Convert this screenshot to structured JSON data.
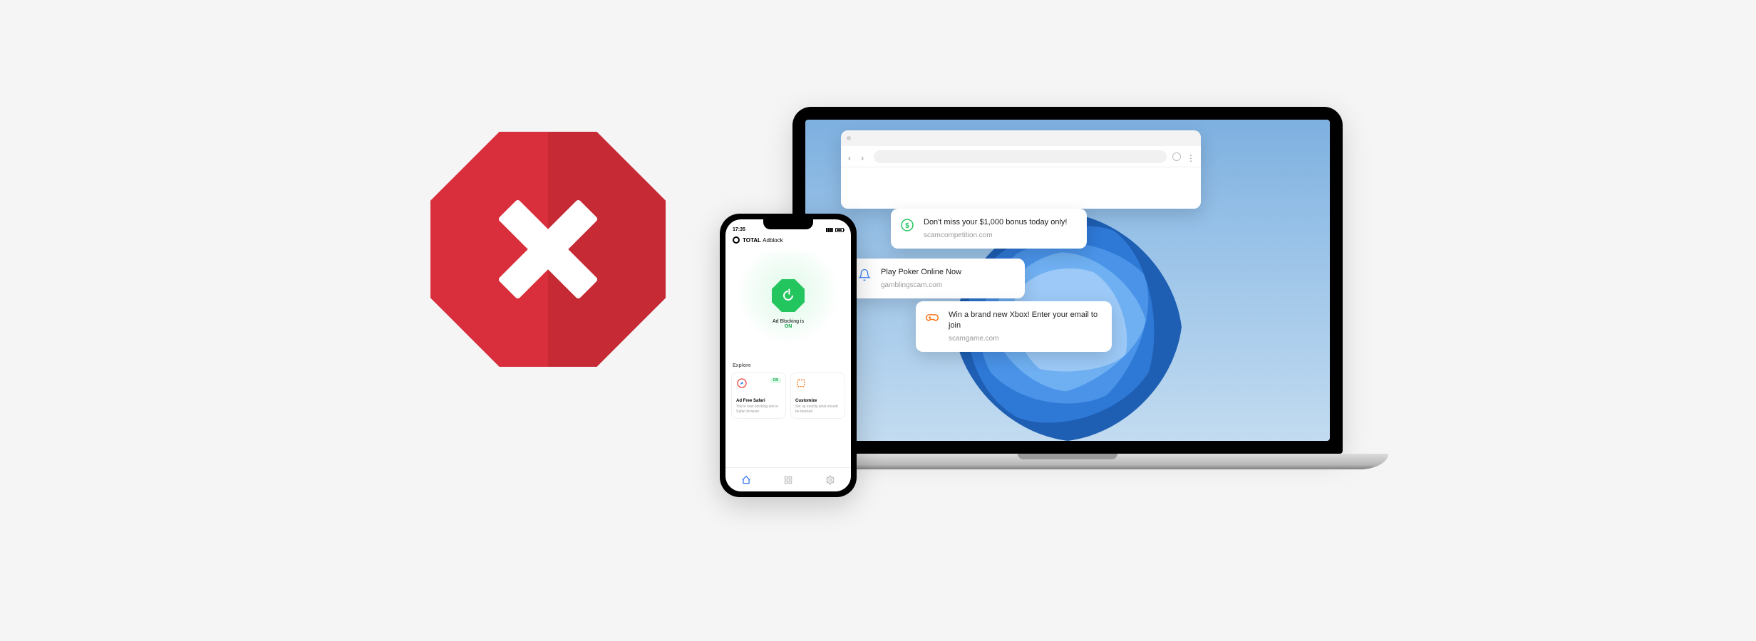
{
  "phone": {
    "status_time": "17:35",
    "app_brand_strong": "TOTAL",
    "app_brand_light": "Adblock",
    "blocking_label": "Ad Blocking is",
    "blocking_state": "ON",
    "explore_header": "Explore",
    "card1": {
      "badge": "ON",
      "title": "Ad Free Safari",
      "desc": "You're now blocking ads in Safari browser"
    },
    "card2": {
      "title": "Customize",
      "desc": "Set up exactly what should be blocked"
    }
  },
  "popups": {
    "p1": {
      "title": "Don't miss your $1,000 bonus today only!",
      "domain": "scamcompetition.com"
    },
    "p2": {
      "title": "Play Poker Online Now",
      "domain": "gamblingscam.com"
    },
    "p3": {
      "title": "Win a brand new Xbox! Enter your email to join",
      "domain": "scamgame.com"
    }
  },
  "colors": {
    "stop_red_left": "#d92e3b",
    "stop_red_right": "#c52a35",
    "green": "#22c55e",
    "blue": "#2563eb"
  }
}
